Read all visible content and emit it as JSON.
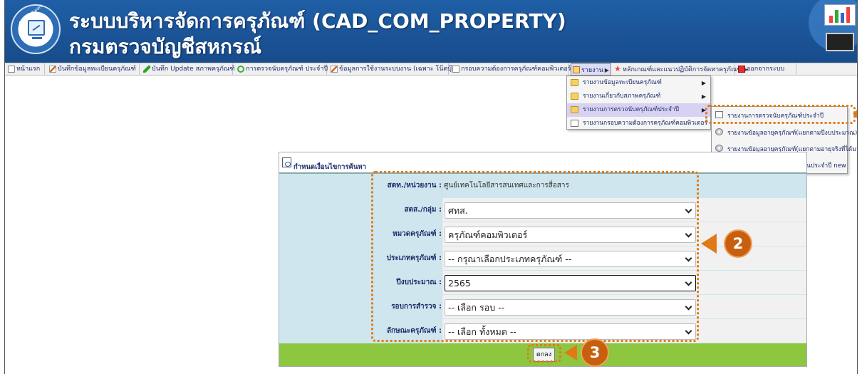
{
  "header": {
    "title_line1": "ระบบบริหารจัดการครุภัณฑ์ (CAD_COM_PROPERTY)",
    "title_line2": "กรมตรวจบัญชีสหกรณ์",
    "logo_text": "CAD Software Center"
  },
  "menubar": [
    {
      "label": "หน้าแรก",
      "icon": "page-icon"
    },
    {
      "label": "บันทึกข้อมูลทะเบียนครุภัณฑ์",
      "icon": "pen-icon"
    },
    {
      "label": "บันทึก Update สภาพครุภัณฑ์",
      "icon": "pencil-icon"
    },
    {
      "label": "การตรวจนับครุภัณฑ์ ประจำปี",
      "icon": "search-icon"
    },
    {
      "label": "ข้อมูลการใช้งานระบบงาน (เฉพาะ โน๊ตบุ๊ก)",
      "icon": "pen-icon"
    },
    {
      "label": "กรอบความต้องการครุภัณฑ์คอมพิวเตอร์",
      "icon": "page-icon"
    },
    {
      "label": "รายงาน",
      "icon": "report-icon"
    },
    {
      "label": "หลักเกณฑ์และแนวปฏิบัติการจัดหาครุภัณฑ์",
      "icon": "star-icon"
    },
    {
      "label": "ออกจากระบบ",
      "icon": "exit-icon"
    }
  ],
  "report_menu": [
    {
      "label": "รายงานข้อมูลทะเบียนครุภัณฑ์",
      "icon": "folder-icon"
    },
    {
      "label": "รายงานเกี่ยวกับสภาพครุภัณฑ์",
      "icon": "folder-icon"
    },
    {
      "label": "รายงานการตรวจนับครุภัณฑ์ประจำปี",
      "icon": "folder-icon"
    },
    {
      "label": "รายงานกรอบความต้องการครุภัณฑ์คอมพิวเตอร์",
      "icon": "doc-icon"
    }
  ],
  "report_submenu": [
    {
      "label": "รายงานการตรวจนับครุภัณฑ์ประจำปี",
      "icon": "doc-icon"
    },
    {
      "label": "รายงานข้อมูลอายุครุภัณฑ์(แยกตามปีงบประมาณ)",
      "icon": "disk-icon"
    },
    {
      "label": "รายงานข้อมูลอายุครุภัณฑ์(แยกตามอายุจริงที่ได้มา)",
      "icon": "disk-icon"
    },
    {
      "label": "รายการทะเบียนครุภัณฑ์ทดแทนประจำปี new",
      "icon": "doc-icon"
    }
  ],
  "panel": {
    "title": "กำหนดเงื่อนไขการค้นหา",
    "fields": [
      {
        "label": "สตท./หน่วยงาน :",
        "value": "ศูนย์เทคโนโลยีสารสนเทศและการสื่อสาร",
        "type": "static"
      },
      {
        "label": "สตส./กลุ่ม :",
        "value": "ศทส.",
        "type": "select"
      },
      {
        "label": "หมวดครุภัณฑ์ :",
        "value": "ครุภัณฑ์คอมพิวเตอร์",
        "type": "select"
      },
      {
        "label": "ประเภทครุภัณฑ์ :",
        "value": "-- กรุณาเลือกประเภทครุภัณฑ์ --",
        "type": "select"
      },
      {
        "label": "ปีงบประมาณ :",
        "value": "2565",
        "type": "select"
      },
      {
        "label": "รอบการสำรวจ :",
        "value": "-- เลือก รอบ --",
        "type": "select"
      },
      {
        "label": "ลักษณะครุภัณฑ์ :",
        "value": "-- เลือก ทั้งหมด --",
        "type": "select"
      }
    ],
    "submit_label": "ตกลง"
  },
  "annotations": {
    "step2": "2",
    "step3": "3",
    "color": "#e07a17"
  }
}
